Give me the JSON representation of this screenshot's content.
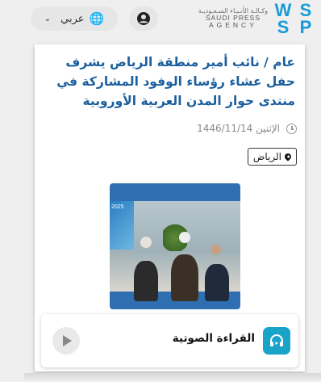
{
  "header": {
    "language_label": "عربي",
    "logo": {
      "arabic_text": "وكـالـة الأنـبـاء السـعـوديـة",
      "english_line1": "SAUDI PRESS",
      "english_line2": "AGENCY",
      "mark_letters": [
        "W",
        "S",
        "S",
        "P"
      ]
    }
  },
  "article": {
    "headline": "عام / نائب أمير منطقة الرياض يشرف حفل عشاء رؤساء الوفود المشاركة في منتدى حوار المدن العربية الأوروبية",
    "date": "الإثنين 1446/11/14",
    "location": "الرياض",
    "photo_caption_year": "2025"
  },
  "audio": {
    "label": "القراءة الصوتية"
  },
  "colors": {
    "headline": "#1b5f9e",
    "accent": "#1aa3c8",
    "logo_blue": "#1a9bd7"
  }
}
